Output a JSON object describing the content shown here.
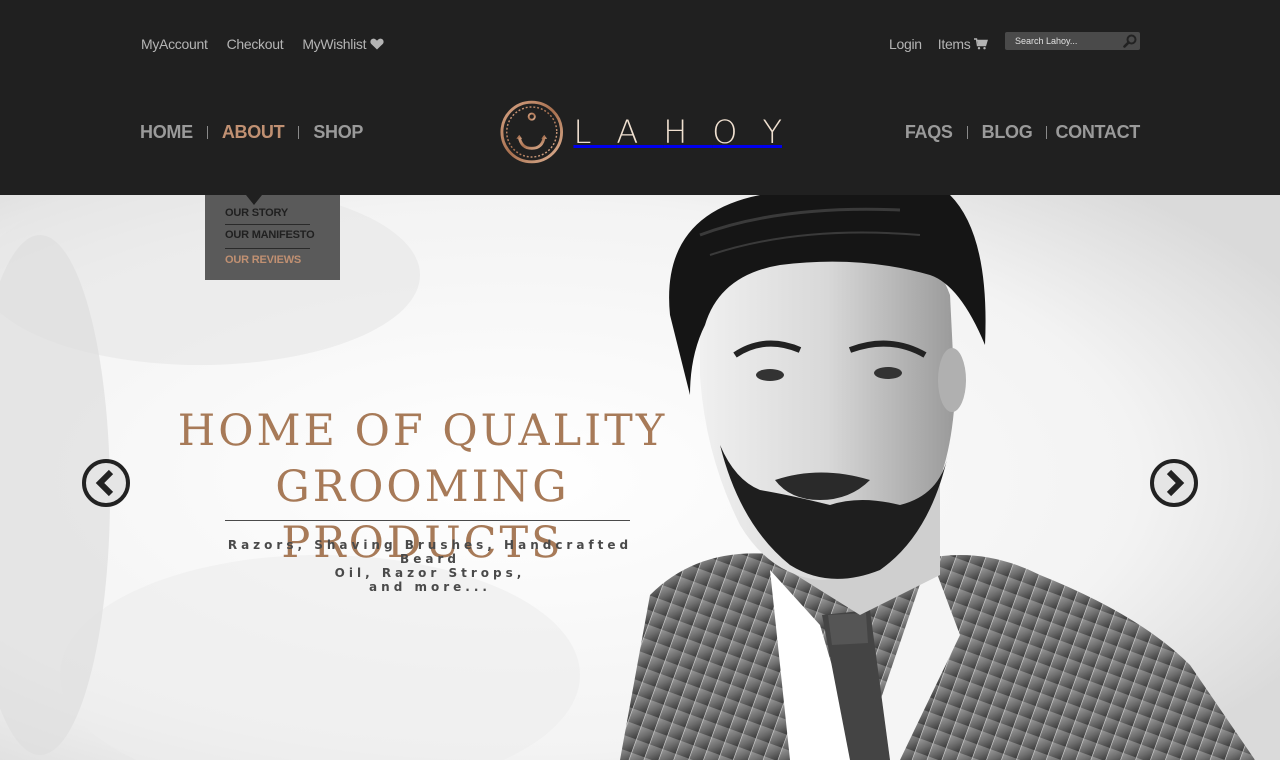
{
  "header": {
    "util_left": {
      "account": "MyAccount",
      "checkout": "Checkout",
      "wishlist": "MyWishlist"
    },
    "util_right": {
      "login": "Login",
      "items": "Items"
    },
    "search": {
      "placeholder": "Search Lahoy..."
    },
    "nav_left": [
      "HOME",
      "ABOUT",
      "SHOP"
    ],
    "nav_right": [
      "FAQS",
      "BLOG",
      "CONTACT"
    ],
    "active_nav": "ABOUT",
    "logo": {
      "letters": [
        "L",
        "A",
        "H",
        "O",
        "Y"
      ]
    }
  },
  "dropdown": {
    "items": [
      "OUR STORY",
      "OUR MANIFESTO",
      "OUR REVIEWS"
    ],
    "active_index": 2
  },
  "hero": {
    "headline_line1": "HOME OF QUALITY",
    "headline_line2": "GROOMING PRODUCTS",
    "sub_line1": "Razors, Shaving Brushes, Handcrafted Beard",
    "sub_line2": "Oil, Razor Strops,",
    "sub_line3": "and more..."
  },
  "colors": {
    "header_bg": "#202020",
    "accent": "#c09072",
    "headline": "#a77a58",
    "nav_text": "#9a9a9a",
    "util_text": "#b4b4b4",
    "dropdown_bg": "#5a5a5a"
  },
  "icons": {
    "wishlist": "heart-icon",
    "items": "cart-icon",
    "search": "magnifier-icon",
    "logo": "anchor-icon",
    "prev": "chevron-left-icon",
    "next": "chevron-right-icon"
  }
}
